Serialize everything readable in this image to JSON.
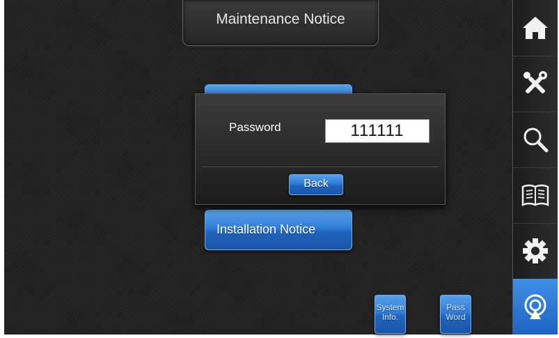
{
  "header": {
    "title": "Maintenance Notice"
  },
  "menu": {
    "install_label": "Installation Notice"
  },
  "password_dialog": {
    "label": "Password",
    "value": "111111",
    "back_label": "Back"
  },
  "bottom_buttons": {
    "system_info_line1": "System",
    "system_info_line2": "Info.",
    "password_line1": "Pass",
    "password_line2": "Word"
  },
  "sidebar": {
    "items": [
      {
        "icon": "home-icon"
      },
      {
        "icon": "tools-icon"
      },
      {
        "icon": "search-icon"
      },
      {
        "icon": "book-icon"
      },
      {
        "icon": "gear-icon"
      },
      {
        "icon": "service-icon",
        "active": true
      }
    ]
  },
  "colors": {
    "accent": "#2f7dd6",
    "background": "#232323"
  }
}
